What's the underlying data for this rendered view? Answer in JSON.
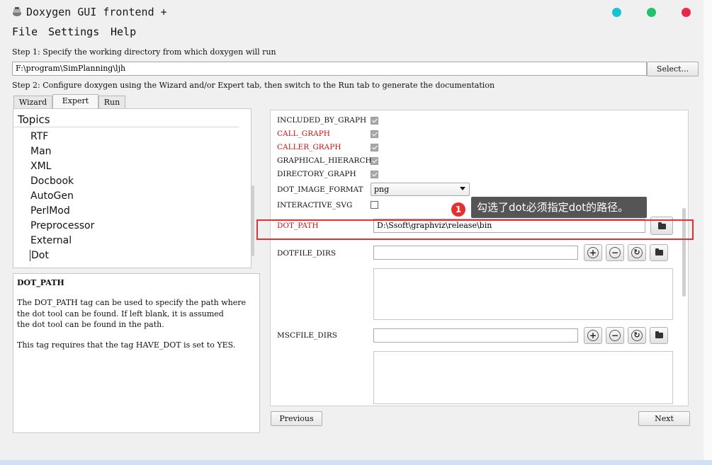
{
  "window": {
    "title": "Doxygen GUI frontend +"
  },
  "menu": [
    "File",
    "Settings",
    "Help"
  ],
  "step1": {
    "text": "Step 1: Specify the working directory from which doxygen will run",
    "path": "F:\\program\\SimPlanning\\ljh",
    "select_label": "Select..."
  },
  "step2": {
    "text": "Step 2: Configure doxygen using the Wizard and/or Expert tab, then switch to the Run tab to generate the documentation"
  },
  "tabs": [
    "Wizard",
    "Expert",
    "Run"
  ],
  "topics": {
    "header": "Topics",
    "items": [
      "RTF",
      "Man",
      "XML",
      "Docbook",
      "AutoGen",
      "PerlMod",
      "Preprocessor",
      "External",
      "Dot"
    ]
  },
  "help": {
    "title": "DOT_PATH",
    "lines": [
      "The DOT_PATH tag can be used to specify the path where",
      "the dot tool can be found. If left blank, it is assumed",
      "the dot tool can be found in the path."
    ],
    "line2": "This tag requires that the tag HAVE_DOT is set to YES."
  },
  "settings": {
    "included_by_graph": "INCLUDED_BY_GRAPH",
    "call_graph": "CALL_GRAPH",
    "caller_graph": "CALLER_GRAPH",
    "graphical_hierarchy": "GRAPHICAL_HIERARCHY",
    "directory_graph": "DIRECTORY_GRAPH",
    "dot_image_format": "DOT_IMAGE_FORMAT",
    "dot_image_format_value": "png",
    "interactive_svg": "INTERACTIVE_SVG",
    "dot_path": "DOT_PATH",
    "dot_path_value": "D:\\Ssoft\\graphviz\\release\\bin",
    "dotfile_dirs": "DOTFILE_DIRS",
    "mscfile_dirs": "MSCFILE_DIRS"
  },
  "annotation": {
    "badge": "1",
    "text": "勾选了dot必须指定dot的路径。"
  },
  "nav": {
    "previous": "Previous",
    "next": "Next"
  },
  "colors": {
    "accent_red": "#e53030",
    "tooltip_bg": "#555555",
    "dot_cyan": "#19c3d4",
    "dot_green": "#22c26a",
    "dot_red": "#e8274f"
  }
}
